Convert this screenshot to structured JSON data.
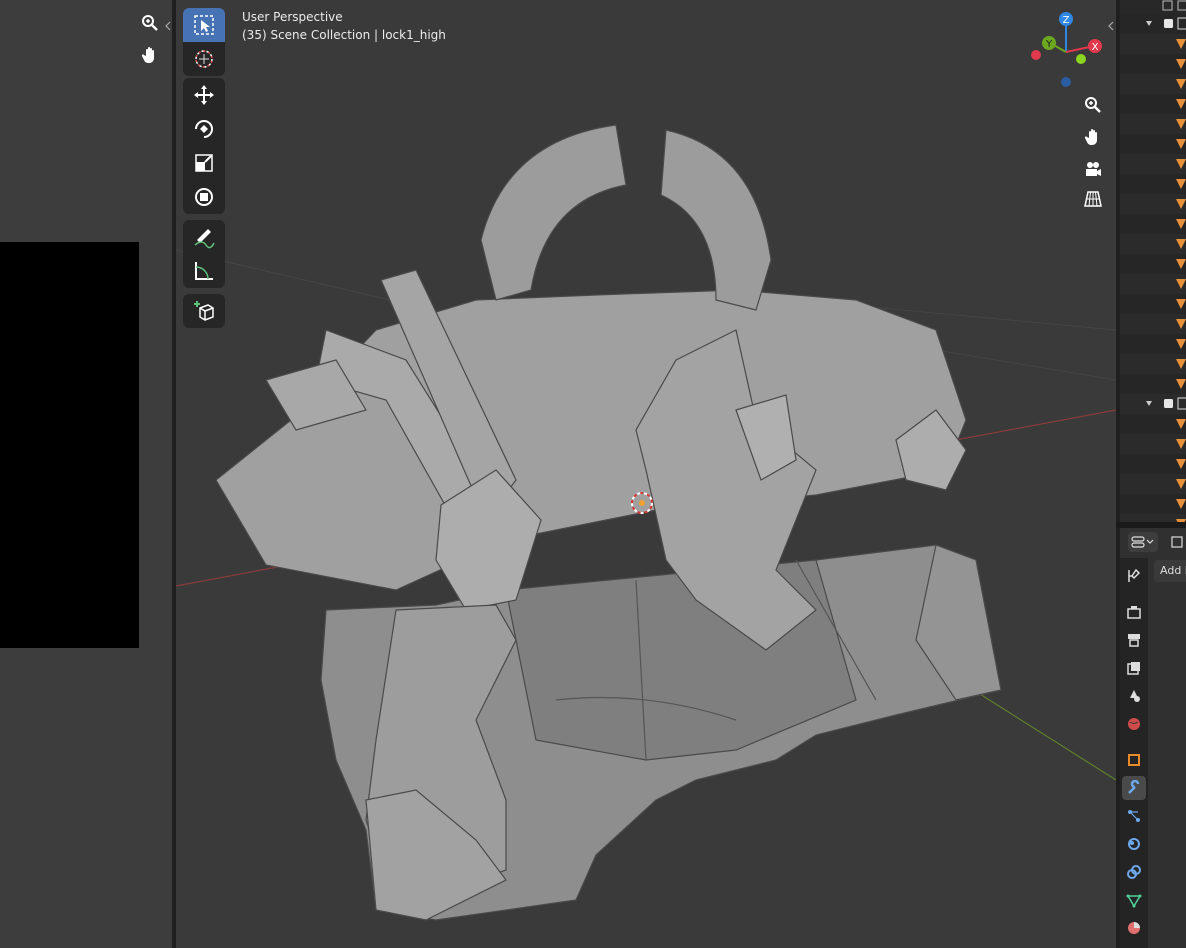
{
  "viewport": {
    "mode_label": "User Perspective",
    "collection_label": "(35) Scene Collection | lock1_high"
  },
  "gizmo": {
    "z_label": "Z",
    "y_label": "Y",
    "x_label": "X",
    "z_color": "#2f86e4",
    "y_color": "#6ca81f",
    "x_color": "#e0384d"
  },
  "properties": {
    "add_modifier_label": "Add M"
  },
  "icons": {
    "left_nav": [
      "zoom-icon",
      "hand-pan-icon"
    ],
    "toolbar": [
      "select-box-icon",
      "cursor-icon",
      "move-icon",
      "rotate-icon",
      "scale-icon",
      "transform-icon",
      "annotate-icon",
      "measure-icon",
      "add-cube-icon"
    ],
    "viewport_nav": [
      "zoom-icon",
      "hand-pan-icon",
      "camera-icon",
      "grid-perspective-icon"
    ],
    "property_tabs": [
      "tool-icon",
      "render-icon",
      "output-icon",
      "view-layer-icon",
      "scene-icon",
      "world-icon",
      "object-icon",
      "modifier-icon",
      "particles-icon",
      "physics-icon",
      "constraints-icon",
      "data-icon",
      "material-icon"
    ]
  },
  "colors": {
    "accent": "#4772b3",
    "viewport_bg": "#3a3a3a",
    "mesh": "#9a9a9a"
  }
}
